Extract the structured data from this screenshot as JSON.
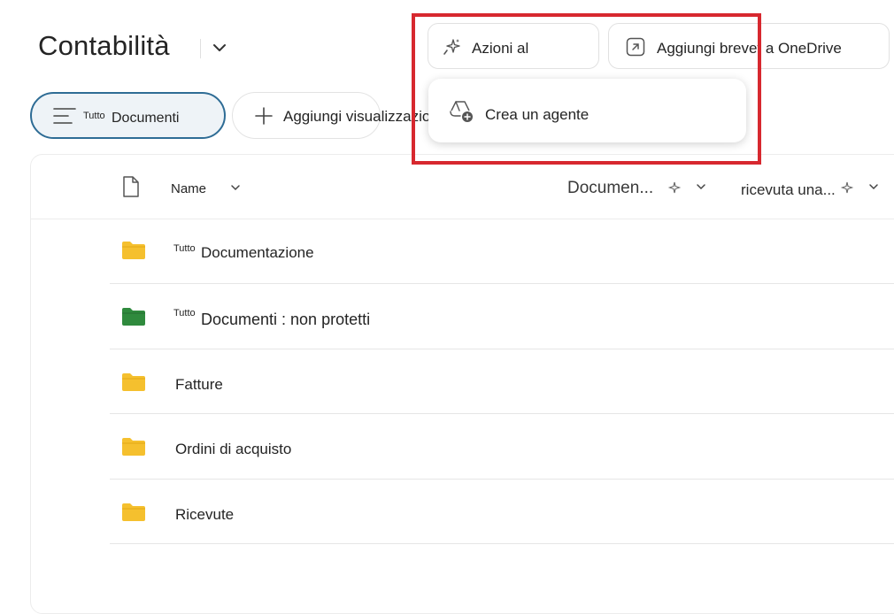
{
  "header": {
    "title": "Contabilità",
    "title_menu_icon": "chevron-down-icon"
  },
  "toolbar": {
    "ai_actions_label": "Azioni al",
    "ai_actions_icon": "sparkle-icon",
    "shortcut_label": "Aggiungi brevet a OneDrive",
    "shortcut_icon": "shortcut-arrow-icon"
  },
  "views": {
    "active_prefix": "Tutto",
    "active_label": "Documenti",
    "active_icon": "filter-lines-icon",
    "add_label": "Aggiungi visualizzazione",
    "add_icon": "plus-icon"
  },
  "menu": {
    "items": [
      {
        "label": "Crea un agente",
        "icon": "agent-create-icon"
      }
    ]
  },
  "columns": {
    "name": "Name",
    "documents": "Documen...",
    "received": "ricevuta una..."
  },
  "rows": [
    {
      "prefix": "Tutto",
      "name": "Documentazione",
      "folder_color": "#f5c02e"
    },
    {
      "prefix": "Tutto",
      "name": "Documenti : non protetti",
      "folder_color": "#2f8a3d"
    },
    {
      "prefix": "",
      "name": "Fatture",
      "folder_color": "#f5c02e"
    },
    {
      "prefix": "",
      "name": "Ordini di acquisto",
      "folder_color": "#f5c02e"
    },
    {
      "prefix": "",
      "name": "Ricevute",
      "folder_color": "#f5c02e"
    }
  ],
  "colors": {
    "highlight": "#d7282f",
    "active_view_border": "#2e6c95"
  }
}
